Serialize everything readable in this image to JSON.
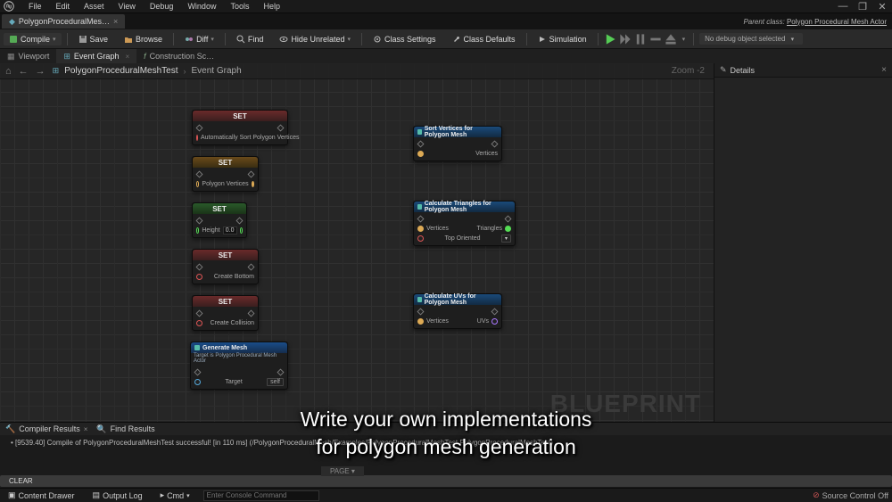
{
  "menu": [
    "File",
    "Edit",
    "Asset",
    "View",
    "Debug",
    "Window",
    "Tools",
    "Help"
  ],
  "fileTab": {
    "label": "PolygonProceduralMes…"
  },
  "parentClass": {
    "prefix": "Parent class:",
    "value": "Polygon Procedural Mesh Actor"
  },
  "toolbar": {
    "compile": "Compile",
    "save": "Save",
    "browse": "Browse",
    "diff": "Diff",
    "find": "Find",
    "hide": "Hide Unrelated",
    "classSettings": "Class Settings",
    "classDefaults": "Class Defaults",
    "simulation": "Simulation",
    "debugSelect": "No debug object selected"
  },
  "subtabs": {
    "viewport": "Viewport",
    "eventGraph": "Event Graph",
    "construction": "Construction Sc…"
  },
  "breadcrumb": {
    "a": "PolygonProceduralMeshTest",
    "b": "Event Graph",
    "zoom": "Zoom -2"
  },
  "watermark": "BLUEPRINT",
  "nodes": {
    "set1_title": "SET",
    "set1_pin": "Automatically Sort Polygon Vertices",
    "set2_title": "SET",
    "set2_pin": "Polygon Vertices",
    "set3_title": "SET",
    "set3_pin": "Height",
    "set3_val": "0.0",
    "set4_title": "SET",
    "set4_pin": "Create Bottom",
    "set5_title": "SET",
    "set5_pin": "Create Collision",
    "gen_title": "Generate Mesh",
    "gen_sub": "Target is Polygon Procedural Mesh Actor",
    "gen_target": "Target",
    "gen_self": "self",
    "sort_title": "Sort Vertices for Polygon Mesh",
    "sort_pin": "Vertices",
    "tri_title": "Calculate Triangles for Polygon Mesh",
    "tri_pin": "Vertices",
    "tri_out": "Triangles",
    "tri_top": "Top Oriented",
    "uv_title": "Calculate UVs for Polygon Mesh",
    "uv_pin": "Vertices",
    "uv_out": "UVs"
  },
  "details": {
    "title": "Details"
  },
  "compiler": {
    "tabA": "Compiler Results",
    "tabB": "Find Results",
    "message": "[9539.40] Compile of PolygonProceduralMeshTest successful! [in 110 ms] (/PolygonProceduralMesh/Examples/PolygonProceduralMeshTest.PolygonProceduralMeshTest)",
    "clear": "CLEAR",
    "page": "PAGE ▾"
  },
  "status": {
    "drawer": "Content Drawer",
    "output": "Output Log",
    "cmd": "Cmd",
    "cmdPlaceholder": "Enter Console Command",
    "source": "Source Control Off"
  },
  "caption": {
    "l1": "Write your own implementations",
    "l2": "for polygon mesh generation"
  }
}
